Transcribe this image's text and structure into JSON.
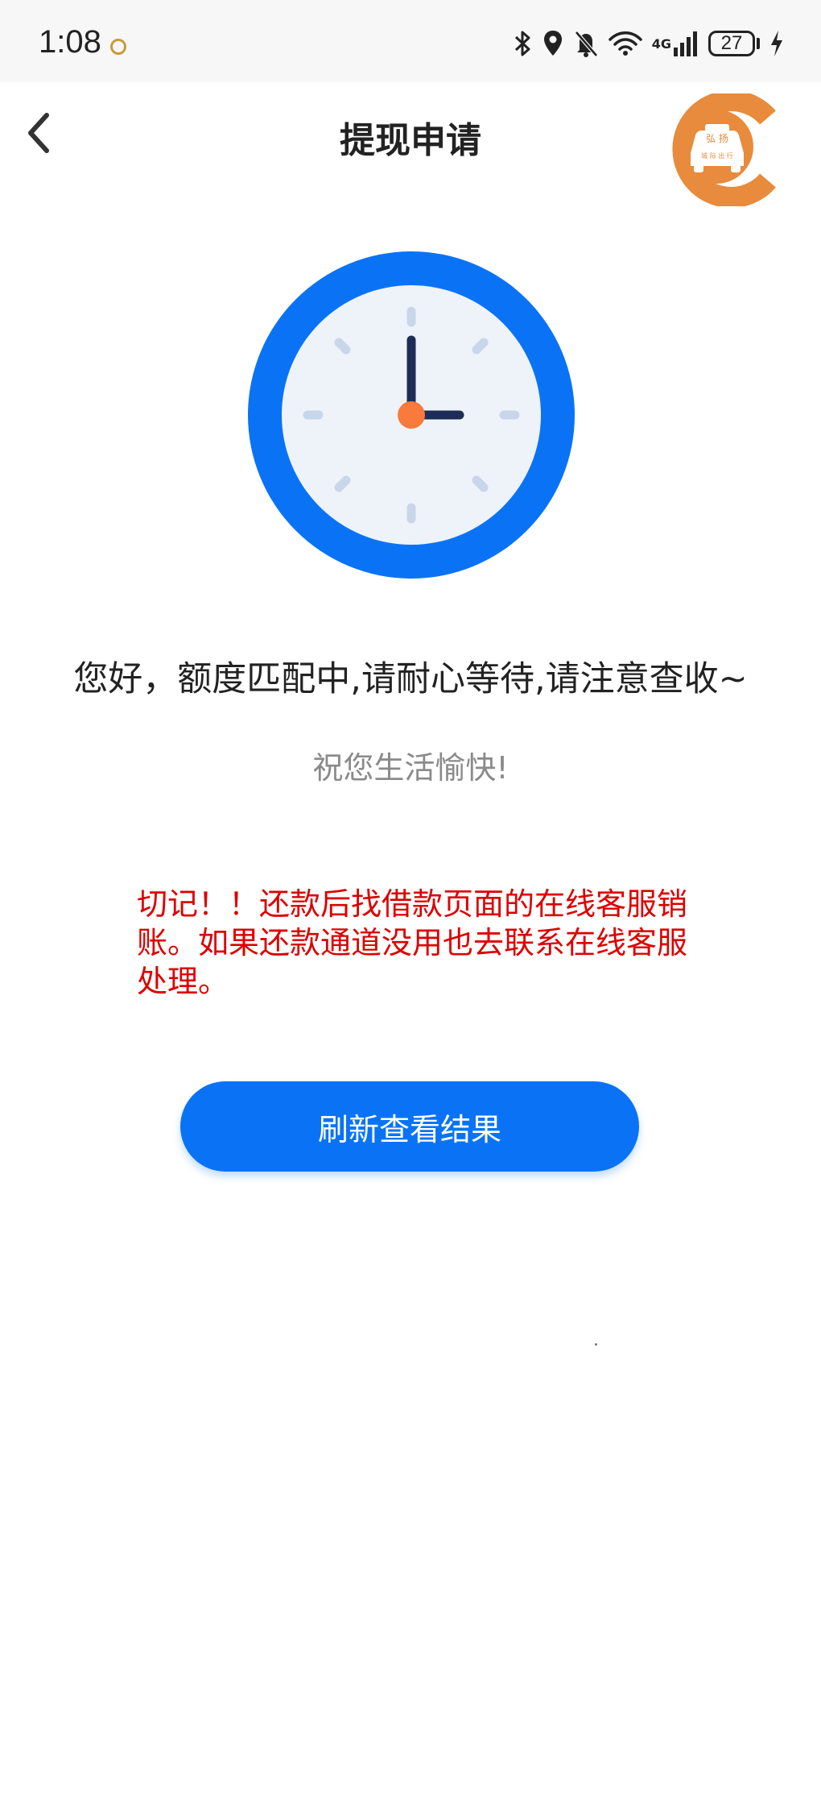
{
  "status_bar": {
    "time": "1:08",
    "network_label": "4G",
    "battery_level": "27",
    "icons": [
      "bluetooth-icon",
      "location-icon",
      "bell-off-icon",
      "wifi-icon",
      "signal-icon",
      "battery-icon",
      "charging-icon"
    ]
  },
  "header": {
    "title": "提现申请",
    "back_icon": "chevron-left-icon",
    "logo_text_top": "弘 扬",
    "logo_text_bottom": "城 际 出 行"
  },
  "main": {
    "clock_icon": "clock-icon",
    "message": "您好，额度匹配中,请耐心等待,请注意查收~",
    "wish": "祝您生活愉快!",
    "warning": "切记！！还款后找借款页面的在线客服销账。如果还款通道没用也去联系在线客服处理。",
    "refresh_label": "刷新查看结果"
  },
  "colors": {
    "accent": "#0a73f5",
    "warning": "#dd0000",
    "logo": "#e88b3c"
  }
}
